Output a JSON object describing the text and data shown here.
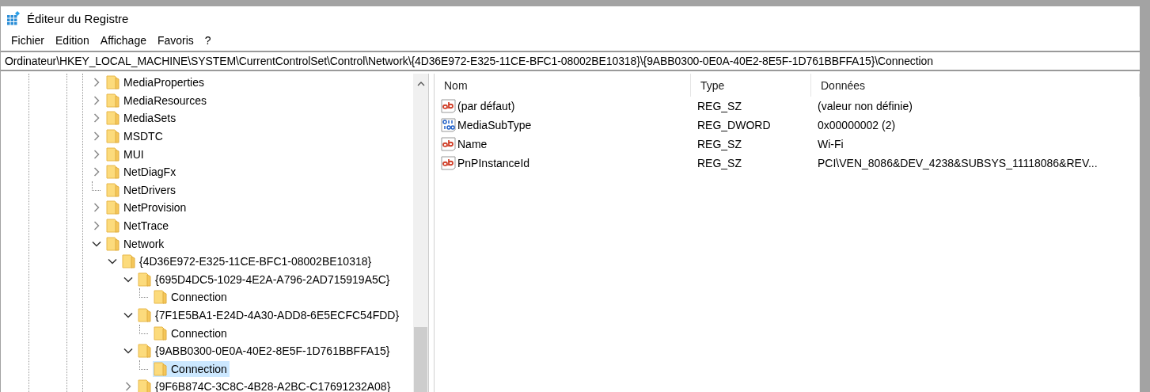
{
  "window": {
    "title": "Éditeur du Registre"
  },
  "menu": [
    "Fichier",
    "Edition",
    "Affichage",
    "Favoris",
    "?"
  ],
  "address": "Ordinateur\\HKEY_LOCAL_MACHINE\\SYSTEM\\CurrentControlSet\\Control\\Network\\{4D36E972-E325-11CE-BFC1-08002BE10318}\\{9ABB0300-0E0A-40E2-8E5F-1D761BBFFA15}\\Connection",
  "tree": [
    {
      "label": "MediaProperties",
      "kind": "branch",
      "expanded": false,
      "selected": false
    },
    {
      "label": "MediaResources",
      "kind": "branch",
      "expanded": false,
      "selected": false
    },
    {
      "label": "MediaSets",
      "kind": "branch",
      "expanded": false,
      "selected": false
    },
    {
      "label": "MSDTC",
      "kind": "branch",
      "expanded": false,
      "selected": false
    },
    {
      "label": "MUI",
      "kind": "branch",
      "expanded": false,
      "selected": false
    },
    {
      "label": "NetDiagFx",
      "kind": "branch",
      "expanded": false,
      "selected": false
    },
    {
      "label": "NetDrivers",
      "kind": "leaf",
      "selected": false
    },
    {
      "label": "NetProvision",
      "kind": "branch",
      "expanded": false,
      "selected": false
    },
    {
      "label": "NetTrace",
      "kind": "branch",
      "expanded": false,
      "selected": false
    },
    {
      "label": "Network",
      "kind": "branch",
      "expanded": true,
      "selected": false,
      "children": [
        {
          "label": "{4D36E972-E325-11CE-BFC1-08002BE10318}",
          "kind": "branch",
          "expanded": true,
          "selected": false,
          "children": [
            {
              "label": "{695D4DC5-1029-4E2A-A796-2AD715919A5C}",
              "kind": "branch",
              "expanded": true,
              "selected": false,
              "children": [
                {
                  "label": "Connection",
                  "kind": "leaf",
                  "selected": false
                }
              ]
            },
            {
              "label": "{7F1E5BA1-E24D-4A30-ADD8-6E5ECFC54FDD}",
              "kind": "branch",
              "expanded": true,
              "selected": false,
              "children": [
                {
                  "label": "Connection",
                  "kind": "leaf",
                  "selected": false
                }
              ]
            },
            {
              "label": "{9ABB0300-0E0A-40E2-8E5F-1D761BBFFA15}",
              "kind": "branch",
              "expanded": true,
              "selected": false,
              "children": [
                {
                  "label": "Connection",
                  "kind": "leaf",
                  "selected": true
                }
              ]
            },
            {
              "label": "{9F6B874C-3C8C-4B28-A2BC-C17691232A08}",
              "kind": "branch",
              "expanded": false,
              "selected": false
            }
          ]
        }
      ]
    }
  ],
  "values": {
    "columns": [
      "Nom",
      "Type",
      "Données"
    ],
    "rows": [
      {
        "kind": "string",
        "name": "(par défaut)",
        "type": "REG_SZ",
        "data": "(valeur non définie)"
      },
      {
        "kind": "binary",
        "name": "MediaSubType",
        "type": "REG_DWORD",
        "data": "0x00000002 (2)"
      },
      {
        "kind": "string",
        "name": "Name",
        "type": "REG_SZ",
        "data": "Wi-Fi"
      },
      {
        "kind": "string",
        "name": "PnPInstanceId",
        "type": "REG_SZ",
        "data": "PCI\\VEN_8086&DEV_4238&SUBSYS_11118086&REV..."
      }
    ]
  }
}
